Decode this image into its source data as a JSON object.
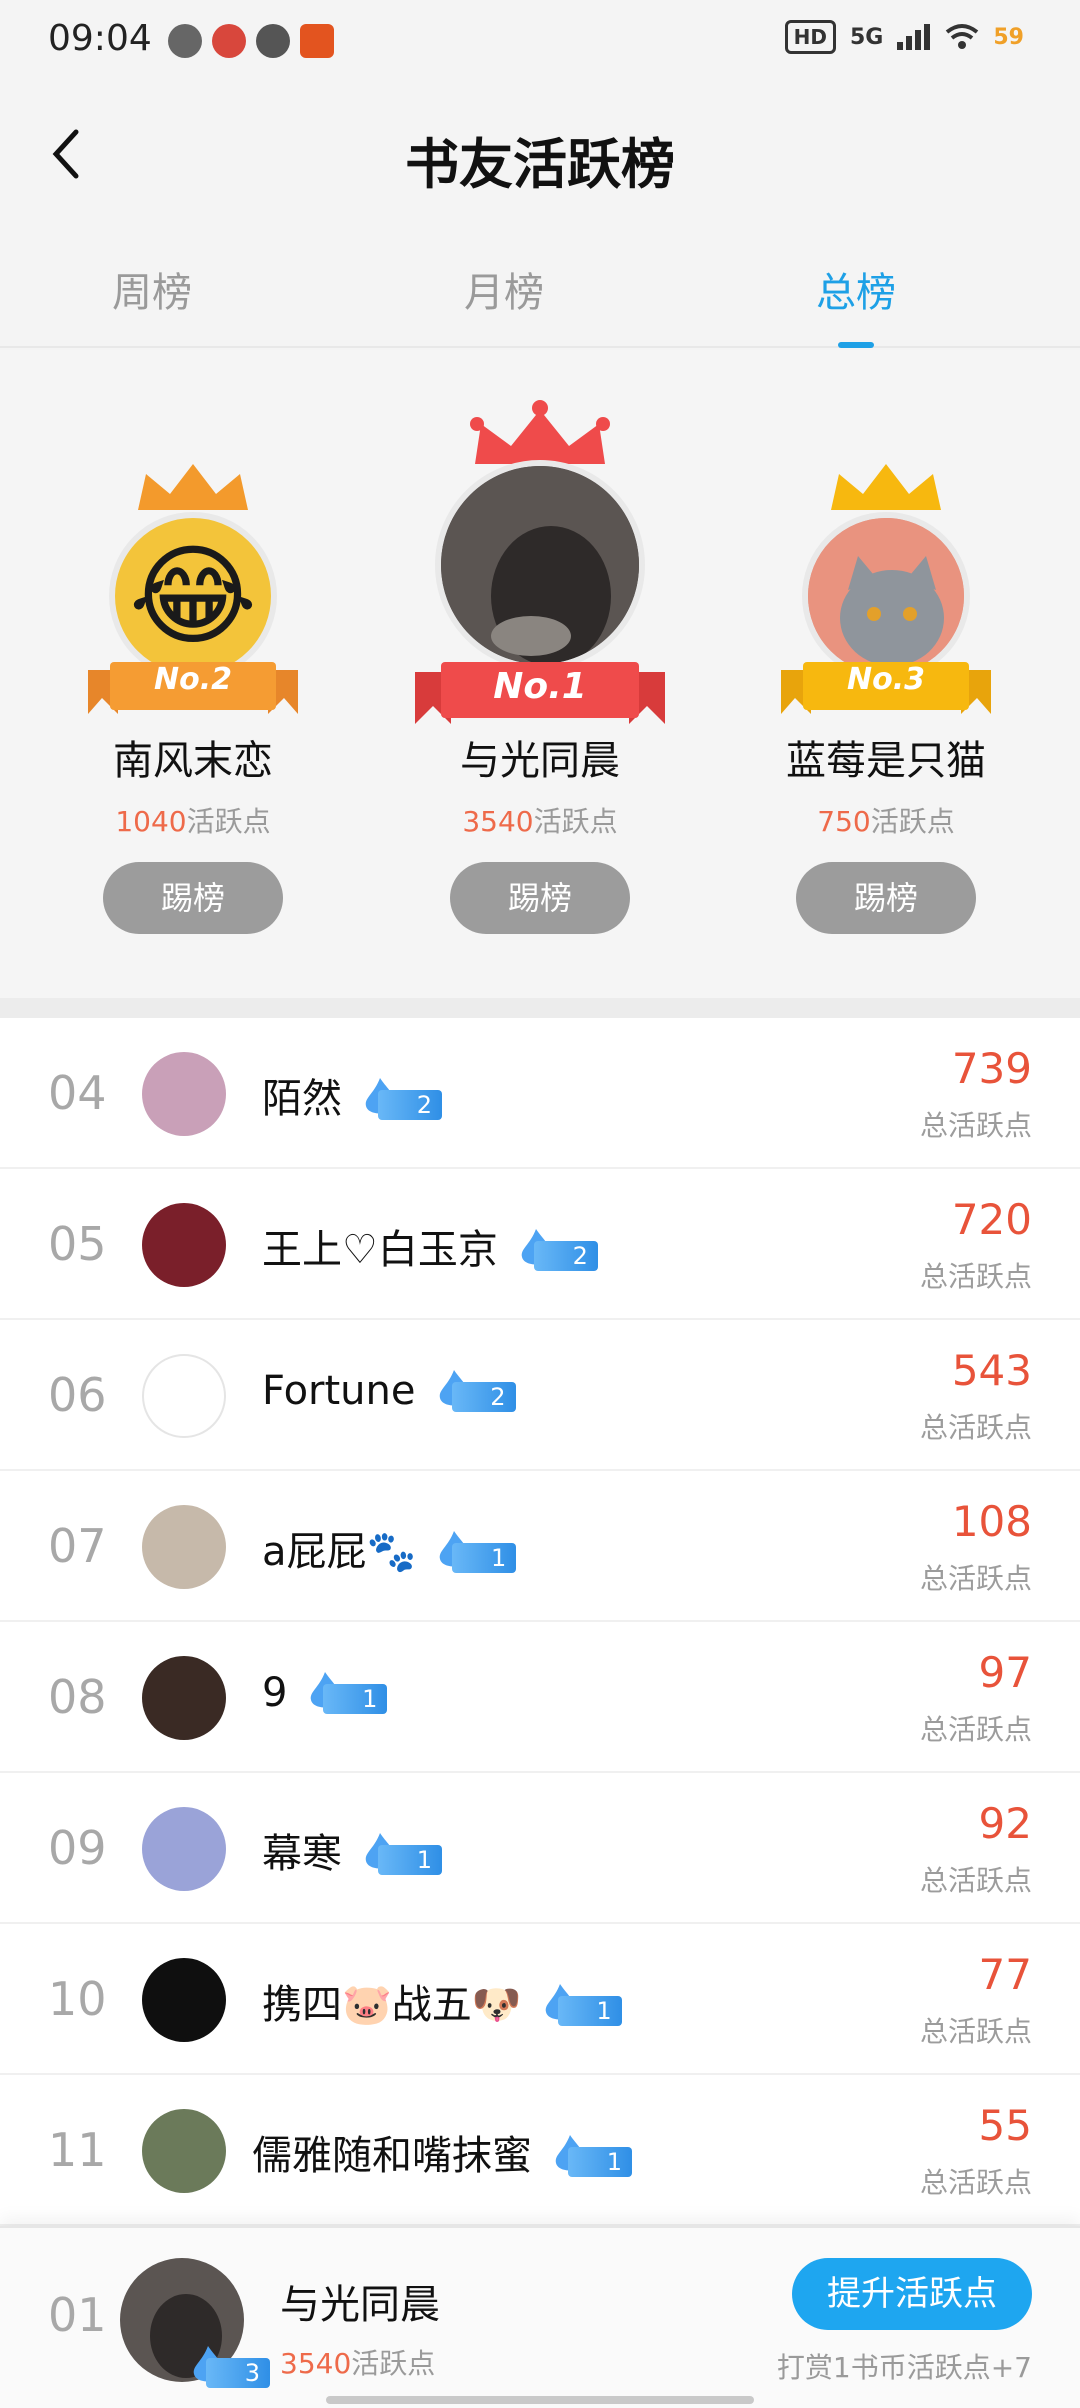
{
  "status_bar": {
    "time": "09:04",
    "icons": [
      "wechat-icon",
      "map-icon",
      "compass-icon",
      "app-icon"
    ],
    "right": {
      "hd": "HD",
      "network": "5G",
      "battery": "59"
    }
  },
  "header": {
    "title": "书友活跃榜",
    "back_icon": "chevron-left-icon"
  },
  "tabs": [
    {
      "label": "周榜",
      "active": false
    },
    {
      "label": "月榜",
      "active": false
    },
    {
      "label": "总榜",
      "active": true
    }
  ],
  "podium": [
    {
      "rank_badge": "No.2",
      "name": "南风末恋",
      "points": "1040",
      "points_suffix": "活跃点",
      "button": "踢榜",
      "crown_color": "#f39a2c"
    },
    {
      "rank_badge": "No.1",
      "name": "与光同晨",
      "points": "3540",
      "points_suffix": "活跃点",
      "button": "踢榜",
      "crown_color": "#ef4b4b"
    },
    {
      "rank_badge": "No.3",
      "name": "蓝莓是只猫",
      "points": "750",
      "points_suffix": "活跃点",
      "button": "踢榜",
      "crown_color": "#f7b80f"
    }
  ],
  "list": [
    {
      "rank": "04",
      "name": "陌然",
      "level": "2",
      "score": "739",
      "score_label": "总活跃点"
    },
    {
      "rank": "05",
      "name": "王上♡白玉京",
      "level": "2",
      "score": "720",
      "score_label": "总活跃点"
    },
    {
      "rank": "06",
      "name": "Fortune",
      "level": "2",
      "score": "543",
      "score_label": "总活跃点"
    },
    {
      "rank": "07",
      "name": "a屁屁🐾",
      "level": "1",
      "score": "108",
      "score_label": "总活跃点"
    },
    {
      "rank": "08",
      "name": "9",
      "level": "1",
      "score": "97",
      "score_label": "总活跃点"
    },
    {
      "rank": "09",
      "name": "幕寒",
      "level": "1",
      "score": "92",
      "score_label": "总活跃点"
    },
    {
      "rank": "10",
      "name": "携四🐷战五🐶",
      "level": "1",
      "score": "77",
      "score_label": "总活跃点"
    },
    {
      "rank": "11",
      "name": "儒雅随和嘴抹蜜",
      "level": "1",
      "score": "55",
      "score_label": "总活跃点"
    }
  ],
  "my_entry": {
    "rank": "01",
    "name": "与光同晨",
    "level": "3",
    "points": "3540",
    "points_suffix": "活跃点",
    "button": "提升活跃点",
    "hint": "打赏1书币活跃点+7"
  },
  "colors": {
    "accent": "#1ea0e6",
    "score": "#e8533a",
    "button_gray": "#9c9c9c"
  }
}
